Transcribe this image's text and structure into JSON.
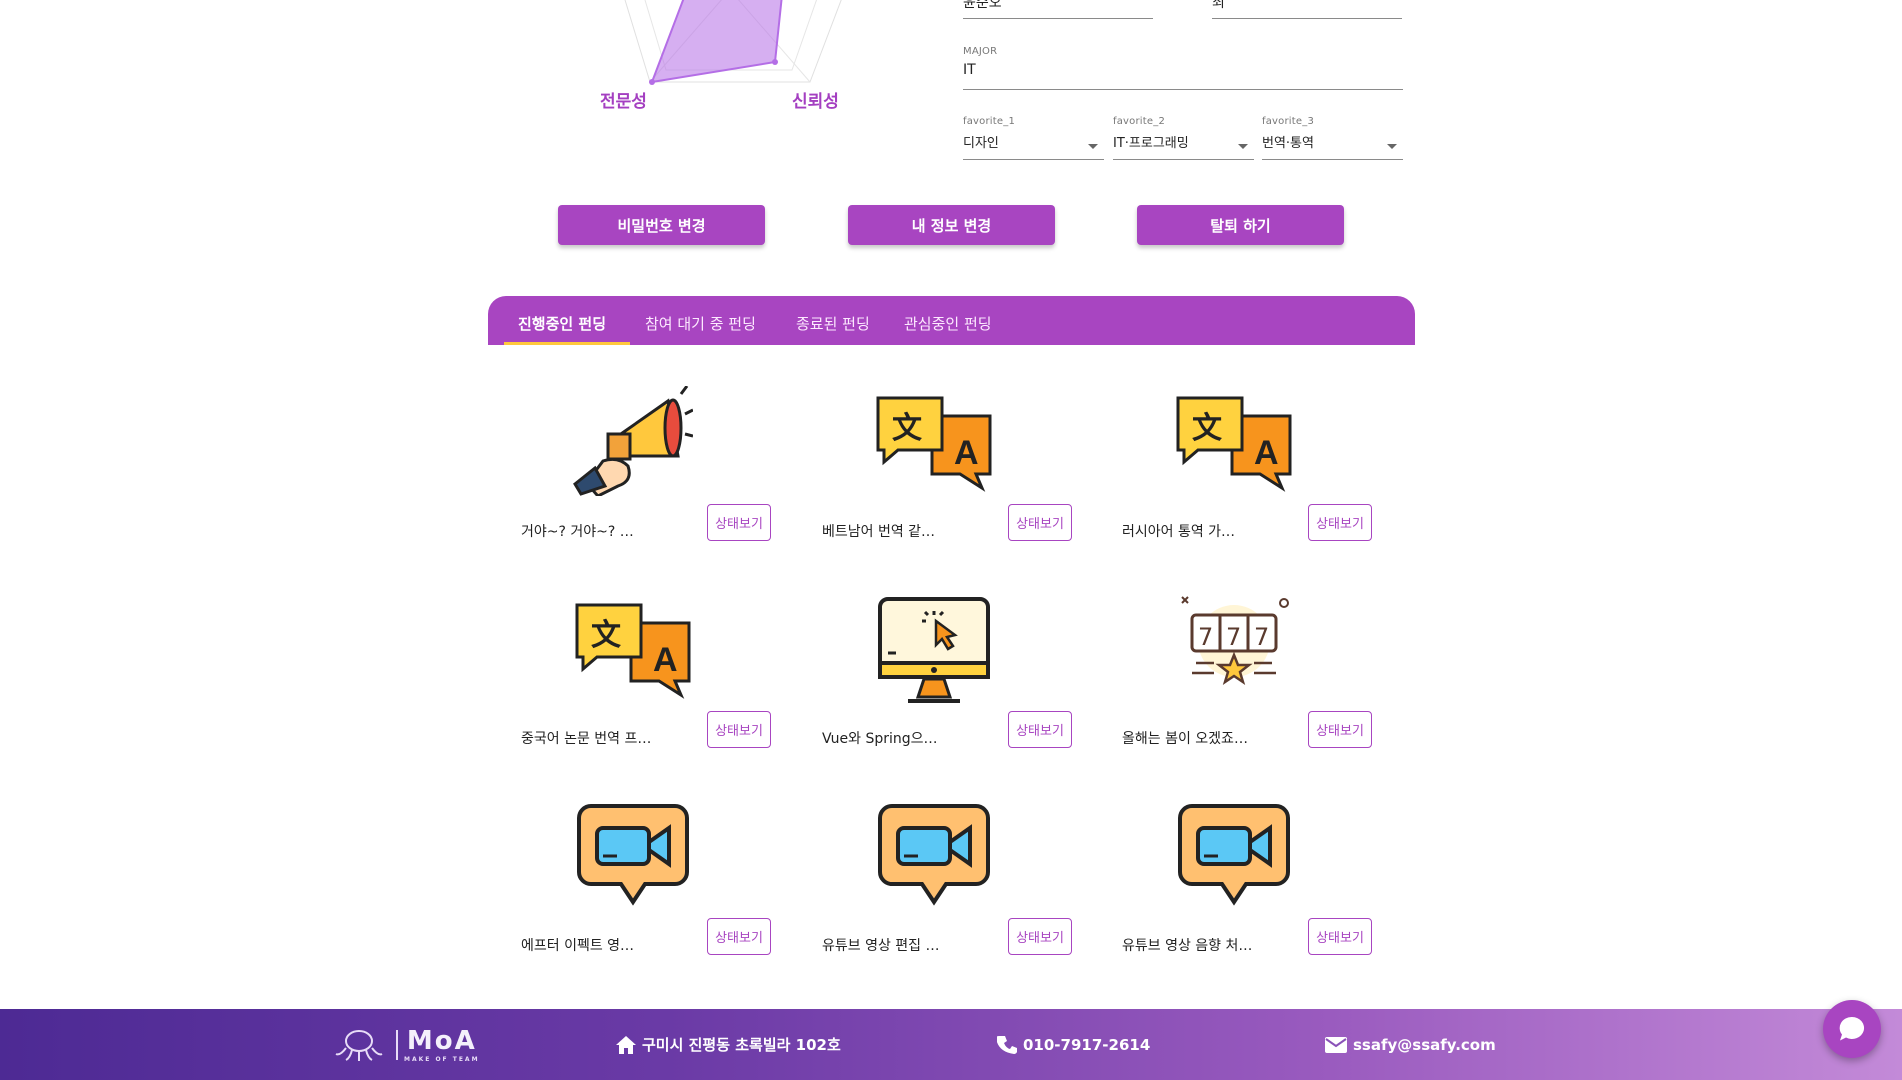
{
  "radar": {
    "labels": [
      "전문성",
      "신뢰성"
    ]
  },
  "profile": {
    "name_value": "윤준오",
    "gender_value": "최",
    "major_label": "MAJOR",
    "major_value": "IT",
    "favorite_1_label": "favorite_1",
    "favorite_1_value": "디자인",
    "favorite_2_label": "favorite_2",
    "favorite_2_value": "IT·프로그래밍",
    "favorite_3_label": "favorite_3",
    "favorite_3_value": "번역·통역"
  },
  "actions": {
    "change_password": "비밀번호 변경",
    "change_info": "내 정보 변경",
    "withdraw": "탈퇴 하기"
  },
  "tabs": [
    {
      "label": "진행중인 펀딩"
    },
    {
      "label": "참여 대기 중 펀딩"
    },
    {
      "label": "종료된 펀딩"
    },
    {
      "label": "관심중인 펀딩"
    }
  ],
  "fundings": [
    {
      "title": "거야~? 거야~? …",
      "icon": "megaphone-icon",
      "status_label": "상태보기"
    },
    {
      "title": "베트남어 번역 같…",
      "icon": "translate-icon",
      "status_label": "상태보기"
    },
    {
      "title": "러시아어 통역 가…",
      "icon": "translate-icon",
      "status_label": "상태보기"
    },
    {
      "title": "중국어 논문 번역 프…",
      "icon": "translate-icon",
      "status_label": "상태보기"
    },
    {
      "title": "Vue와 Spring으…",
      "icon": "monitor-cursor-icon",
      "status_label": "상태보기"
    },
    {
      "title": "올해는 봄이 오겠죠…",
      "icon": "slot-machine-icon",
      "status_label": "상태보기"
    },
    {
      "title": "에프터 이펙트 영…",
      "icon": "video-chat-icon",
      "status_label": "상태보기"
    },
    {
      "title": "유튜브 영상 편집 …",
      "icon": "video-chat-icon",
      "status_label": "상태보기"
    },
    {
      "title": "유튜브 영상 음향 처…",
      "icon": "video-chat-icon",
      "status_label": "상태보기"
    }
  ],
  "footer": {
    "logo": "MoA",
    "logo_sub": "MAKE OF TEAM",
    "address": "구미시 진평동 초록빌라 102호",
    "phone": "010-7917-2614",
    "email": "ssafy@ssafy.com"
  },
  "colors": {
    "primary": "#a845c1",
    "tab_indicator": "#ffc83d",
    "footer_start": "#4d2a94",
    "footer_end": "#c38ad8"
  }
}
